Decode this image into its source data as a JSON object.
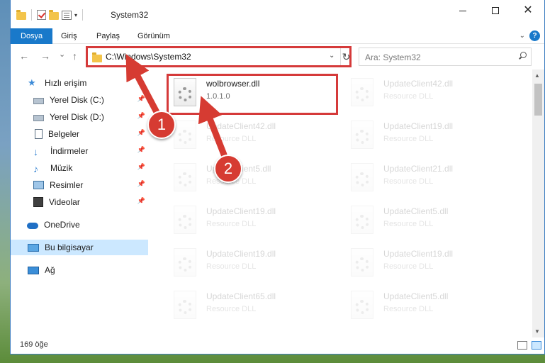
{
  "window": {
    "title": "System32",
    "controls": {
      "minimize": "—",
      "maximize": "☐",
      "close": "✕"
    }
  },
  "ribbon": {
    "tabs": [
      {
        "label": "Dosya",
        "active": true
      },
      {
        "label": "Giriş"
      },
      {
        "label": "Paylaş"
      },
      {
        "label": "Görünüm"
      }
    ],
    "help": "?"
  },
  "navigation": {
    "back": "←",
    "forward": "→",
    "recent": "⌄",
    "up": "↑",
    "address": "C:\\Windows\\System32",
    "refresh": "↻",
    "search_placeholder": "Ara: System32"
  },
  "sidebar": {
    "items": [
      {
        "label": "Hızlı erişim",
        "icon": "quick-access-icon"
      },
      {
        "label": "Yerel Disk (C:)",
        "icon": "drive-icon",
        "pinned": true
      },
      {
        "label": "Yerel Disk (D:)",
        "icon": "drive-icon",
        "pinned": true
      },
      {
        "label": "Belgeler",
        "icon": "documents-icon",
        "pinned": true
      },
      {
        "label": "İndirmeler",
        "icon": "downloads-icon",
        "pinned": true
      },
      {
        "label": "Müzik",
        "icon": "music-icon",
        "pinned": true
      },
      {
        "label": "Resimler",
        "icon": "pictures-icon",
        "pinned": true
      },
      {
        "label": "Videolar",
        "icon": "videos-icon",
        "pinned": true
      },
      {
        "label": "OneDrive",
        "icon": "onedrive-icon"
      },
      {
        "label": "Bu bilgisayar",
        "icon": "this-pc-icon",
        "selected": true
      },
      {
        "label": "Ağ",
        "icon": "network-icon"
      }
    ]
  },
  "files": [
    {
      "name": "wolbrowser.dll",
      "sub": "1.0.1.0",
      "highlighted": true
    },
    {
      "name": "UpdateClient42.dll",
      "sub": "Resource DLL"
    },
    {
      "name": "UpdateClient42.dll",
      "sub": "Resource DLL"
    },
    {
      "name": "UpdateClient19.dll",
      "sub": "Resource DLL"
    },
    {
      "name": "UpdateClient5.dll",
      "sub": "Resource DLL"
    },
    {
      "name": "UpdateClient21.dll",
      "sub": "Resource DLL"
    },
    {
      "name": "UpdateClient19.dll",
      "sub": "Resource DLL"
    },
    {
      "name": "UpdateClient5.dll",
      "sub": "Resource DLL"
    },
    {
      "name": "UpdateClient19.dll",
      "sub": "Resource DLL"
    },
    {
      "name": "UpdateClient19.dll",
      "sub": "Resource DLL"
    },
    {
      "name": "UpdateClient65.dll",
      "sub": "Resource DLL"
    },
    {
      "name": "UpdateClient5.dll",
      "sub": "Resource DLL"
    }
  ],
  "status": {
    "item_count": "169 öğe"
  },
  "annotations": {
    "badge1": "1",
    "badge2": "2",
    "color": "#d63b32"
  }
}
